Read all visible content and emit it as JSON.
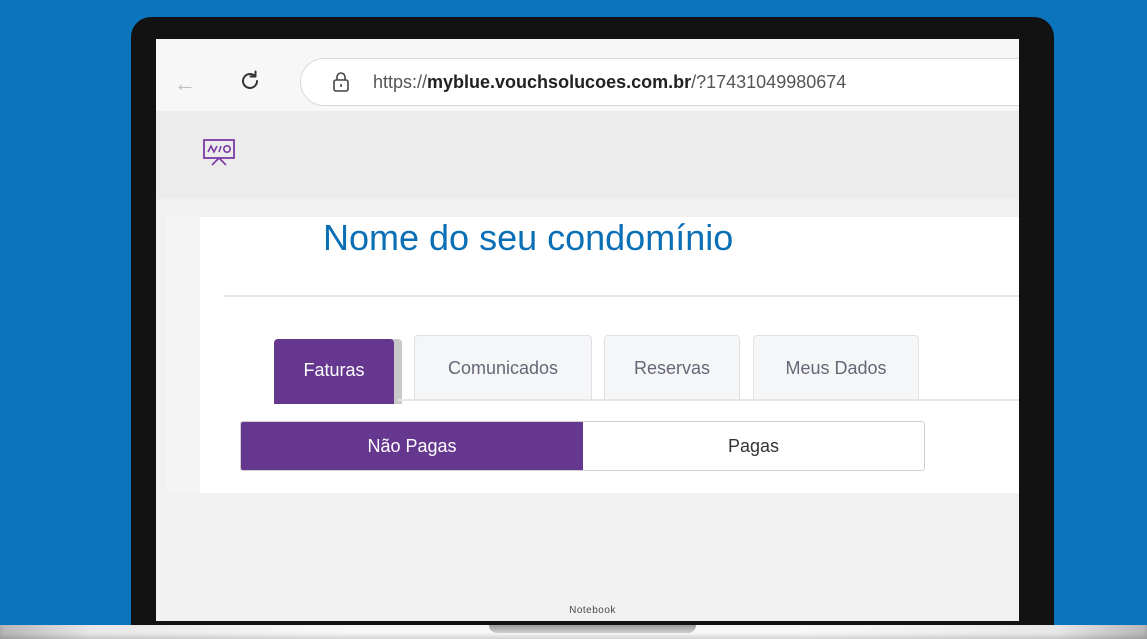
{
  "browser": {
    "url_prefix": "https://",
    "url_domain": "myblue.vouchsolucoes.com.br",
    "url_suffix": "/?17431049980674"
  },
  "app": {
    "logo_icon": "presentation-board-icon",
    "title": "Nome do seu condomínio",
    "tabs": [
      {
        "label": "Faturas",
        "active": true
      },
      {
        "label": "Comunicados",
        "active": false
      },
      {
        "label": "Reservas",
        "active": false
      },
      {
        "label": "Meus Dados",
        "active": false
      }
    ],
    "filter": {
      "options": [
        "Não Pagas",
        "Pagas"
      ],
      "selected": "Não Pagas"
    }
  },
  "device": {
    "label": "Notebook"
  },
  "colors": {
    "background": "#0a74bd",
    "accent": "#66378f",
    "title": "#0b6fb6"
  }
}
